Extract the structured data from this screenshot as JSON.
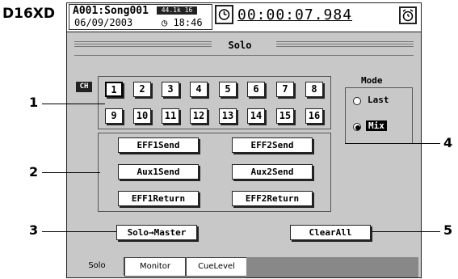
{
  "model": "D16XD",
  "header": {
    "song": "A001:Song001",
    "sample_rate": "44.1k 16",
    "date": "06/09/2003",
    "time": "◷ 18:46",
    "counter": "00:00:07.984"
  },
  "title": "Solo",
  "channels": {
    "label": "CH",
    "row1": [
      "1",
      "2",
      "3",
      "4",
      "5",
      "6",
      "7",
      "8"
    ],
    "row2": [
      "9",
      "10",
      "11",
      "12",
      "13",
      "14",
      "15",
      "16"
    ]
  },
  "sends": {
    "eff1_send": "EFF1Send",
    "eff2_send": "EFF2Send",
    "aux1_send": "Aux1Send",
    "aux2_send": "Aux2Send",
    "eff1_return": "EFF1Return",
    "eff2_return": "EFF2Return"
  },
  "mode": {
    "label": "Mode",
    "last": "Last",
    "mix": "Mix",
    "selected": "Mix"
  },
  "buttons": {
    "solo_master": "Solo→Master",
    "clear_all": "ClearAll"
  },
  "tabs": [
    "Solo",
    "Monitor",
    "CueLevel"
  ],
  "callouts": [
    "1",
    "2",
    "3",
    "4",
    "5"
  ]
}
